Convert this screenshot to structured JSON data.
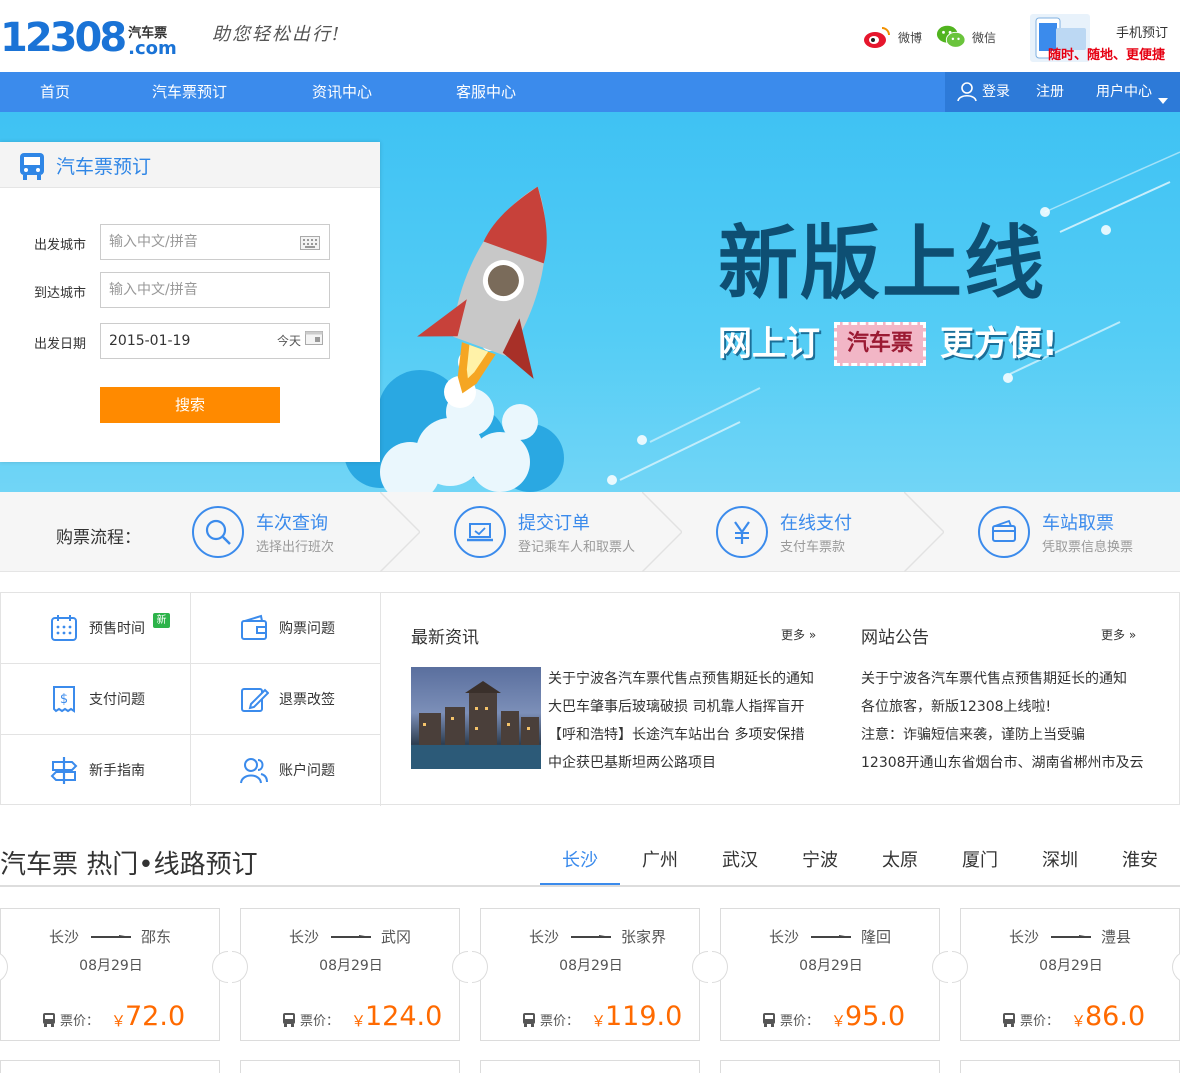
{
  "header": {
    "logo_number": "12308",
    "logo_cn": "汽车票",
    "logo_domain": ".com",
    "slogan": "助您轻松出行!",
    "weibo_label": "微博",
    "wechat_label": "微信",
    "mobile_title": "手机预订",
    "mobile_tagline": "随时、随地、更便捷"
  },
  "nav": {
    "items": [
      "首页",
      "汽车票预订",
      "资讯中心",
      "客服中心"
    ],
    "login": "登录",
    "register": "注册",
    "user_center": "用户中心"
  },
  "banner": {
    "title": "新版上线",
    "sub_left": "网上订",
    "sub_box": "汽车票",
    "sub_right": "更方便!"
  },
  "booking": {
    "title": "汽车票预订",
    "from_label": "出发城市",
    "from_placeholder": "输入中文/拼音",
    "to_label": "到达城市",
    "to_placeholder": "输入中文/拼音",
    "date_label": "出发日期",
    "date_value": "2015-01-19",
    "date_today": "今天",
    "search_button": "搜索"
  },
  "process": {
    "label": "购票流程：",
    "steps": [
      {
        "title": "车次查询",
        "desc": "选择出行班次"
      },
      {
        "title": "提交订单",
        "desc": "登记乘车人和取票人"
      },
      {
        "title": "在线支付",
        "desc": "支付车票款"
      },
      {
        "title": "车站取票",
        "desc": "凭取票信息换票"
      }
    ]
  },
  "help": {
    "items": [
      "预售时间",
      "购票问题",
      "支付问题",
      "退票改签",
      "新手指南",
      "账户问题"
    ],
    "new_badge": "新"
  },
  "news": {
    "title": "最新资讯",
    "more": "更多",
    "items": [
      "关于宁波各汽车票代售点预售期延长的通知",
      "大巴车肇事后玻璃破损  司机靠人指挥盲开",
      "【呼和浩特】长途汽车站出台  多项安保措",
      "中企获巴基斯坦两公路项目"
    ]
  },
  "notice": {
    "title": "网站公告",
    "more": "更多",
    "items": [
      "关于宁波各汽车票代售点预售期延长的通知",
      "各位旅客，新版12308上线啦!",
      "注意：诈骗短信来袭，谨防上当受骗",
      "12308开通山东省烟台市、湖南省郴州市及云"
    ]
  },
  "hot": {
    "title": "汽车票 热门•线路预订",
    "tabs": [
      "长沙",
      "广州",
      "武汉",
      "宁波",
      "太原",
      "厦门",
      "深圳",
      "淮安"
    ],
    "active_tab": "长沙",
    "price_label": "票价：",
    "currency": "￥",
    "routes": [
      {
        "from": "长沙",
        "to": "邵东",
        "date": "08月29日",
        "price": "72.0"
      },
      {
        "from": "长沙",
        "to": "武冈",
        "date": "08月29日",
        "price": "124.0"
      },
      {
        "from": "长沙",
        "to": "张家界",
        "date": "08月29日",
        "price": "119.0"
      },
      {
        "from": "长沙",
        "to": "隆回",
        "date": "08月29日",
        "price": "95.0"
      },
      {
        "from": "长沙",
        "to": "澧县",
        "date": "08月29日",
        "price": "86.0"
      }
    ]
  },
  "colors": {
    "brand_blue": "#3b8bec",
    "accent_orange": "#ff8a00",
    "price_orange": "#ff6a00"
  }
}
